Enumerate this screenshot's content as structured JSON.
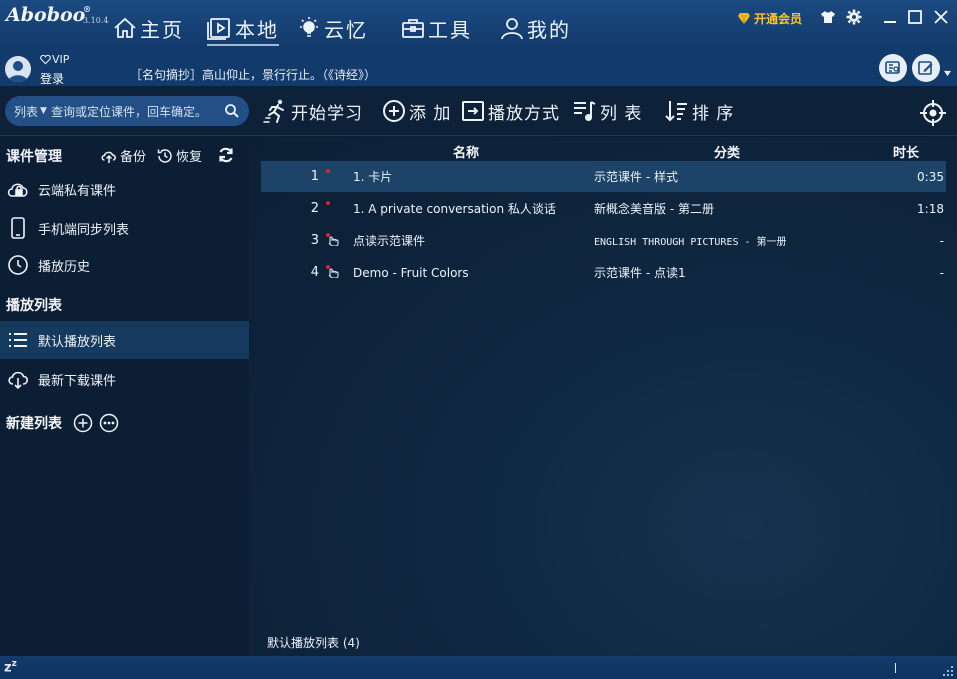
{
  "app": {
    "logo": "Aboboo",
    "version": "3.10.4",
    "registered": "®"
  },
  "nav": {
    "tabs": [
      {
        "label": "主页"
      },
      {
        "label": "本地"
      },
      {
        "label": "云忆"
      },
      {
        "label": "工具"
      },
      {
        "label": "我的"
      }
    ],
    "vip_button": "开通会员"
  },
  "user": {
    "vip": "VIP",
    "login": "登录",
    "quote": "［名句摘抄］高山仰止，景行行止。（《诗经》）"
  },
  "toolbar": {
    "search_mode": "列表",
    "search_placeholder": "查询或定位课件，回车确定。",
    "start_learning": "开始学习",
    "add": "添 加",
    "play_mode": "播放方式",
    "list": "列 表",
    "sort": "排 序"
  },
  "sidebar": {
    "course_mgmt": "课件管理",
    "backup": "备份",
    "restore": "恢复",
    "items": [
      {
        "label": "云端私有课件"
      },
      {
        "label": "手机端同步列表"
      },
      {
        "label": "播放历史"
      }
    ],
    "playlists_title": "播放列表",
    "playlists": [
      {
        "label": "默认播放列表"
      },
      {
        "label": "最新下载课件"
      }
    ],
    "new_list": "新建列表"
  },
  "list": {
    "columns": {
      "name": "名称",
      "category": "分类",
      "duration": "时长"
    },
    "rows": [
      {
        "num": "1",
        "name": "1. 卡片",
        "category": "示范课件 - 样式",
        "duration": "0:35",
        "mark": "dot"
      },
      {
        "num": "2",
        "name": "1. A private conversation 私人谈话",
        "category": "新概念美音版 - 第二册",
        "duration": "1:18",
        "mark": "dot"
      },
      {
        "num": "3",
        "name": "点读示范课件",
        "category": "ENGLISH THROUGH PICTURES - 第一册",
        "duration": "-",
        "mark": "hand"
      },
      {
        "num": "4",
        "name": "Demo - Fruit Colors",
        "category": "示范课件 - 点读1",
        "duration": "-",
        "mark": "hand"
      }
    ],
    "footer": "默认播放列表 (4)"
  },
  "status": {
    "sleep": "z",
    "sleep_sup": "z"
  },
  "colors": {
    "title_bar": "#1b4a82",
    "background": "#0c1e33",
    "selected_row": "#1d4468",
    "vip_gold": "#ffc524",
    "marker_red": "#e0202a"
  }
}
